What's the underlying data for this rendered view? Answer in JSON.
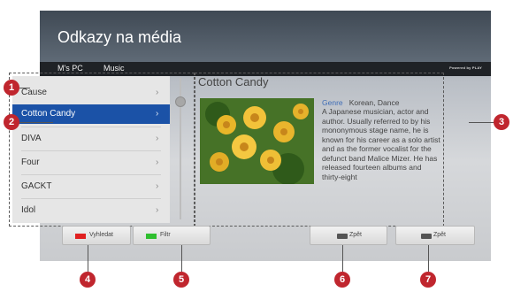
{
  "header": {
    "title": "Odkazy na média"
  },
  "nav": {
    "items": [
      "M's PC",
      "Music"
    ],
    "powered": "Powered by PLAY"
  },
  "list": {
    "items": [
      "Cause",
      "Cotton Candy",
      "DIVA",
      "Four",
      "GACKT",
      "Idol"
    ],
    "selected_index": 1
  },
  "detail": {
    "title": "Cotton Candy",
    "genre_label": "Genre",
    "genre_value": "Korean, Dance",
    "description": "A Japanese musician, actor and author. Usually referred to by his mononymous stage name, he is known for his career as a solo artist and as the former vocalist for the defunct band Malice Mizer. He has released fourteen albums and thirty-eight"
  },
  "buttons": [
    {
      "label": "Vyhledat",
      "key_color": "#e02020"
    },
    {
      "label": "Filtr",
      "key_color": "#2fbf2f"
    },
    {
      "label": "Zpět"
    },
    {
      "label": "Zpět"
    }
  ],
  "markers": [
    "1",
    "2",
    "3",
    "4",
    "5",
    "6",
    "7"
  ],
  "colors": {
    "selection": "#1b52a7",
    "marker": "#c0262e"
  }
}
